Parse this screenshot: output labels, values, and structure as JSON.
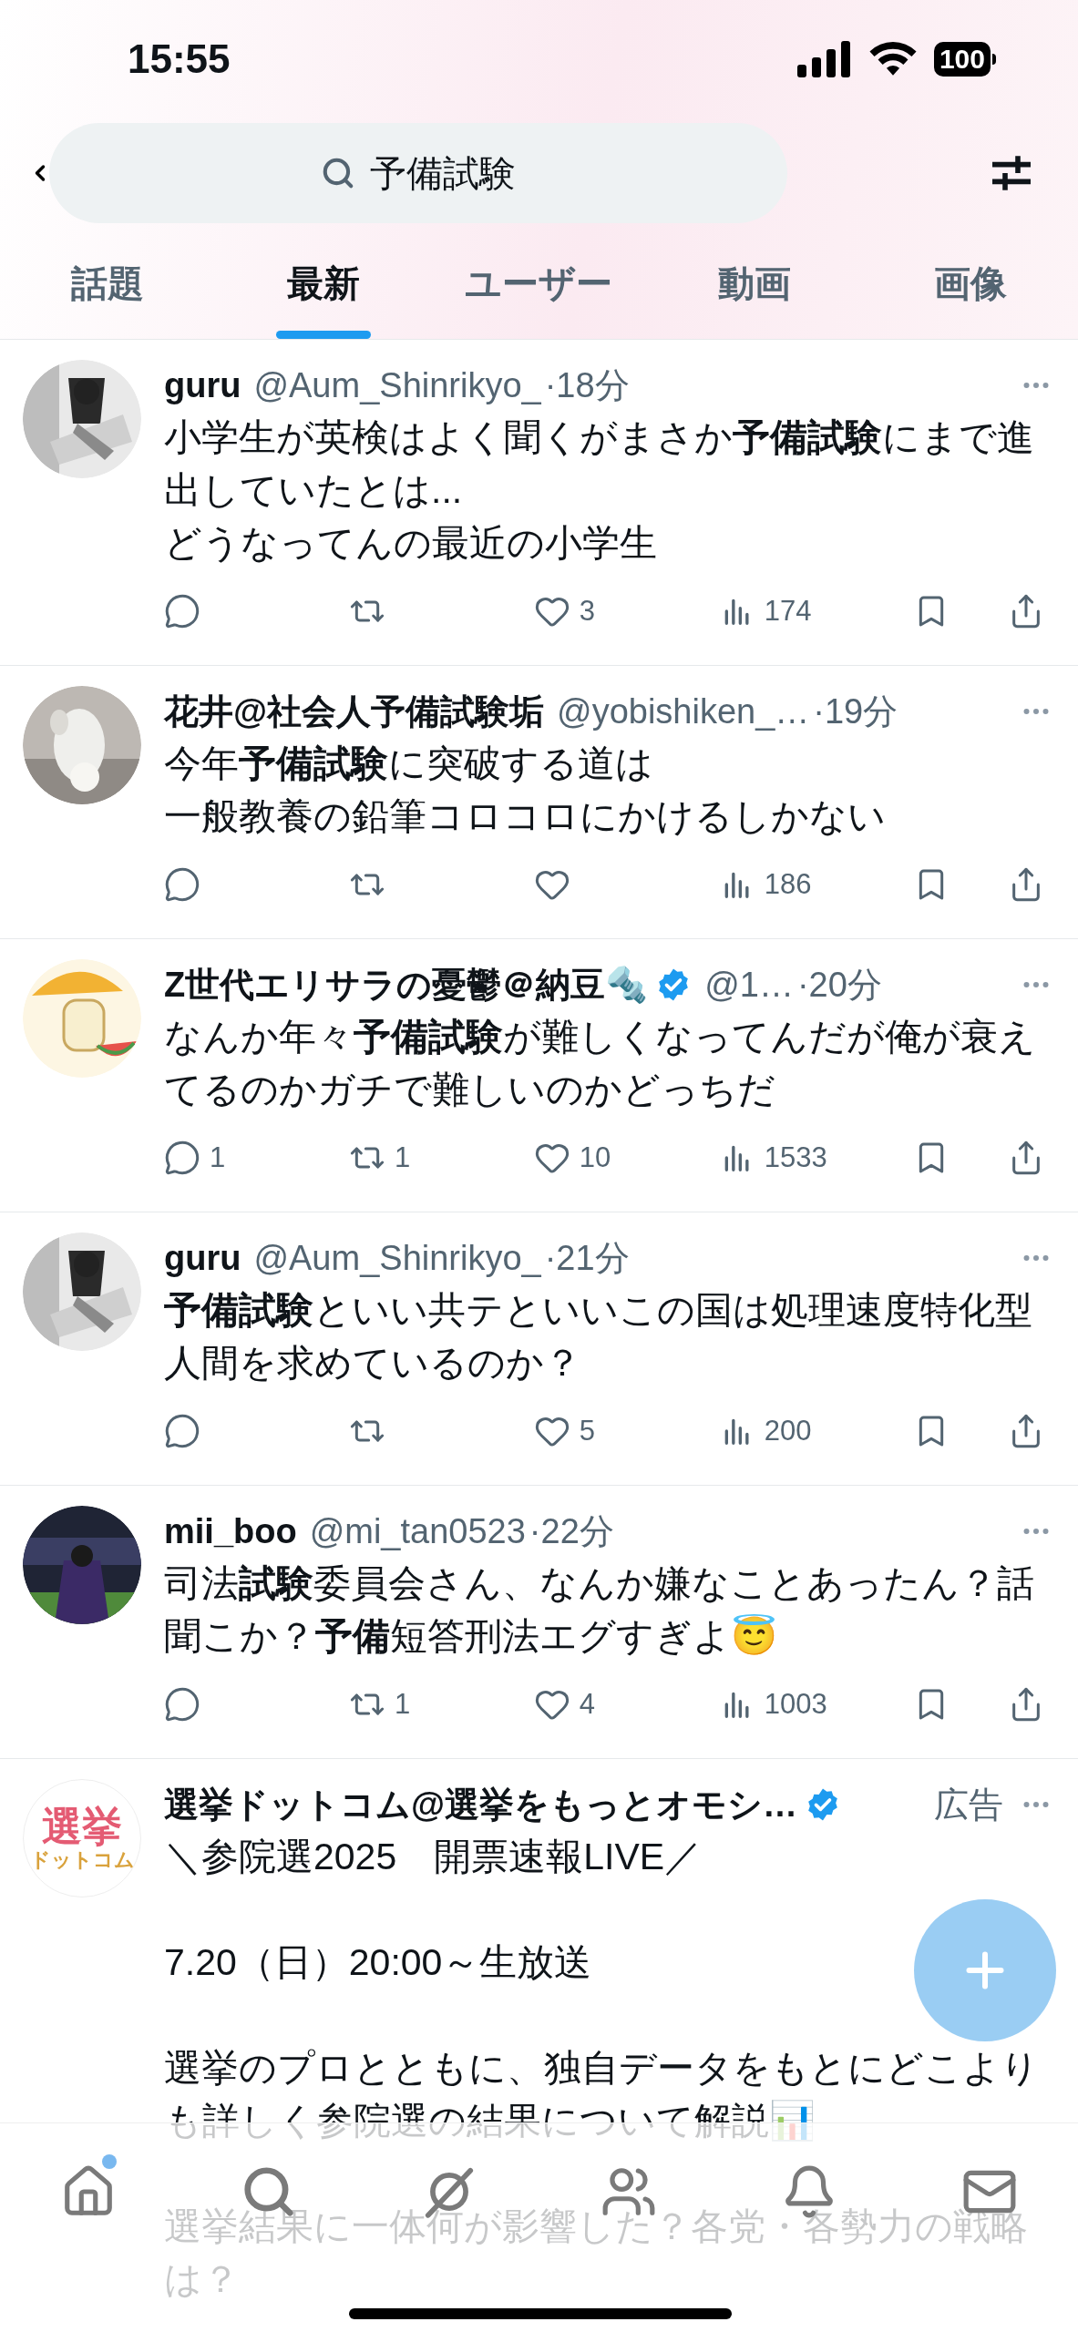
{
  "status_bar": {
    "time": "15:55",
    "battery": "100"
  },
  "search": {
    "value": "予備試験"
  },
  "tabs": [
    {
      "label": "話題",
      "selected": false
    },
    {
      "label": "最新",
      "selected": true
    },
    {
      "label": "ユーザー",
      "selected": false
    },
    {
      "label": "動画",
      "selected": false
    },
    {
      "label": "画像",
      "selected": false
    }
  ],
  "tweets": [
    {
      "avatar": {
        "kind": "picture"
      },
      "name": "guru",
      "verified": false,
      "handle": "@Aum_Shinrikyo_",
      "time": "·18分",
      "paragraphs": [
        [
          "小学生が英検はよく聞くがまさか**予備試験**にまで進出していたとは...",
          "どうなってんの最近の小学生"
        ]
      ],
      "actions": [
        {
          "kind": "reply"
        },
        {
          "kind": "retweet"
        },
        {
          "kind": "like",
          "count": "3"
        },
        {
          "kind": "views",
          "count": "174"
        },
        {
          "kind": "bookmark"
        },
        {
          "kind": "share"
        }
      ]
    },
    {
      "avatar": {
        "kind": "picture"
      },
      "name": "花井@社会人予備試験垢",
      "verified": false,
      "handle": "@yobishiken_…",
      "time": "·19分",
      "paragraphs": [
        [
          "今年**予備試験**に突破する道は",
          "一般教養の鉛筆コロコロにかけるしかない"
        ]
      ],
      "actions": [
        {
          "kind": "reply"
        },
        {
          "kind": "retweet"
        },
        {
          "kind": "like"
        },
        {
          "kind": "views",
          "count": "186"
        },
        {
          "kind": "bookmark"
        },
        {
          "kind": "share"
        }
      ]
    },
    {
      "avatar": {
        "kind": "picture"
      },
      "name": "Z世代エリサラの憂鬱＠納豆🔩",
      "verified": true,
      "handle": "@1…",
      "time": "·20分",
      "paragraphs": [
        [
          "なんか年々**予備試験**が難しくなってんだが俺が衰えてるのかガチで難しいのかどっちだ"
        ]
      ],
      "actions": [
        {
          "kind": "reply",
          "count": "1"
        },
        {
          "kind": "retweet",
          "count": "1"
        },
        {
          "kind": "like",
          "count": "10"
        },
        {
          "kind": "views",
          "count": "1533"
        },
        {
          "kind": "bookmark"
        },
        {
          "kind": "share"
        }
      ]
    },
    {
      "avatar": {
        "kind": "picture"
      },
      "name": "guru",
      "verified": false,
      "handle": "@Aum_Shinrikyo_",
      "time": "·21分",
      "paragraphs": [
        [
          "**予備試験**といい共テといいこの国は処理速度特化型人間を求めているのか？"
        ]
      ],
      "actions": [
        {
          "kind": "reply"
        },
        {
          "kind": "retweet"
        },
        {
          "kind": "like",
          "count": "5"
        },
        {
          "kind": "views",
          "count": "200"
        },
        {
          "kind": "bookmark"
        },
        {
          "kind": "share"
        }
      ]
    },
    {
      "avatar": {
        "kind": "picture"
      },
      "name": "mii_boo",
      "verified": false,
      "handle": "@mi_tan0523",
      "time": "·22分",
      "paragraphs": [
        [
          "司法**試験**委員会さん、なんか嫌なことあったん？話聞こか？**予備**短答刑法エグすぎよ😇"
        ]
      ],
      "actions": [
        {
          "kind": "reply"
        },
        {
          "kind": "retweet",
          "count": "1"
        },
        {
          "kind": "like",
          "count": "4"
        },
        {
          "kind": "views",
          "count": "1003"
        },
        {
          "kind": "bookmark"
        },
        {
          "kind": "share"
        }
      ]
    },
    {
      "avatar": {
        "kind": "logo",
        "lines": [
          "選挙",
          "ドットコム"
        ]
      },
      "name": "選挙ドットコム@選挙をもっとオモシ…",
      "verified": true,
      "ad_label": "広告",
      "paragraphs": [
        [
          "＼参院選2025　開票速報LIVE／"
        ],
        [
          "7.20（日）20:00～生放送"
        ],
        [
          "選挙のプロとともに、独自データをもとにどこよりも詳しく参院選の結果について解説📊"
        ],
        [
          "選挙結果に一体何が影響した？各党・各勢力の戦略は？"
        ]
      ]
    }
  ],
  "nav": [
    {
      "kind": "home",
      "dot": true
    },
    {
      "kind": "search",
      "dot": false
    },
    {
      "kind": "grok",
      "dot": false
    },
    {
      "kind": "communities",
      "dot": false
    },
    {
      "kind": "notifications",
      "dot": false
    },
    {
      "kind": "messages",
      "dot": false
    }
  ]
}
